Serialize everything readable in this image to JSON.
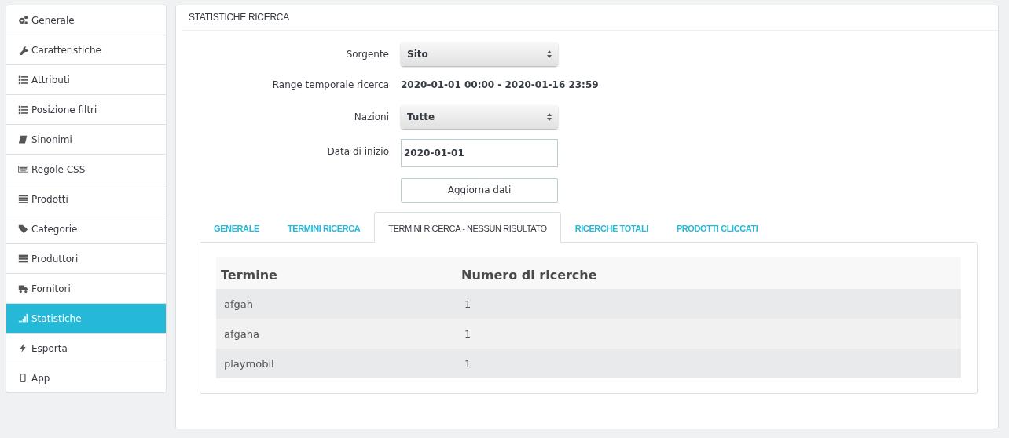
{
  "sidebar": {
    "items": [
      {
        "label": "Generale",
        "selected": false
      },
      {
        "label": "Caratteristiche",
        "selected": false
      },
      {
        "label": "Attributi",
        "selected": false
      },
      {
        "label": "Posizione filtri",
        "selected": false
      },
      {
        "label": "Sinonimi",
        "selected": false
      },
      {
        "label": "Regole CSS",
        "selected": false
      },
      {
        "label": "Prodotti",
        "selected": false
      },
      {
        "label": "Categorie",
        "selected": false
      },
      {
        "label": "Produttori",
        "selected": false
      },
      {
        "label": "Fornitori",
        "selected": false
      },
      {
        "label": "Statistiche",
        "selected": true
      },
      {
        "label": "Esporta",
        "selected": false
      },
      {
        "label": "App",
        "selected": false
      }
    ]
  },
  "panel": {
    "title": "STATISTICHE RICERCA",
    "form": [
      {
        "kind": "select",
        "label": "Sorgente",
        "value": "Sito"
      },
      {
        "kind": "text",
        "label": "Range temporale ricerca",
        "value": "2020-01-01 00:00 - 2020-01-16 23:59"
      },
      {
        "kind": "select",
        "label": "Nazioni",
        "value": "Tutte"
      },
      {
        "kind": "input",
        "label": "Data di inizio",
        "value": "2020-01-01"
      },
      {
        "kind": "button",
        "value": "Aggiorna dati"
      }
    ],
    "tabs": [
      {
        "label": "GENERALE",
        "selected": false
      },
      {
        "label": "TERMINI RICERCA",
        "selected": false
      },
      {
        "label": "TERMINI RICERCA - NESSUN RISULTATO",
        "selected": true
      },
      {
        "label": "RICERCHE TOTALI",
        "selected": false
      },
      {
        "label": "PRODOTTI CLICCATI",
        "selected": false
      }
    ],
    "table": {
      "columns": [
        "Termine",
        "Numero di ricerche"
      ],
      "rows": [
        [
          "afgah",
          "1"
        ],
        [
          "afgaha",
          "1"
        ],
        [
          "playmobil",
          "1"
        ]
      ]
    }
  }
}
